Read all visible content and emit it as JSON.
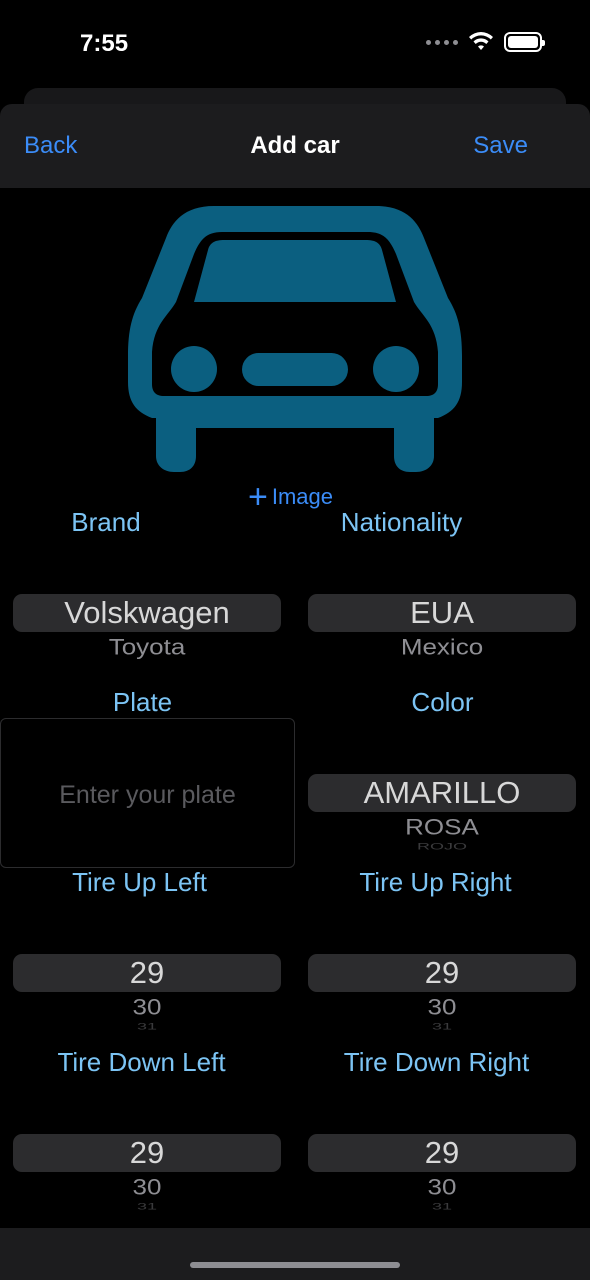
{
  "status": {
    "time": "7:55"
  },
  "nav": {
    "back": "Back",
    "title": "Add car",
    "save": "Save"
  },
  "image": {
    "add_label": "Image"
  },
  "fields": {
    "brand": {
      "label": "Brand",
      "selected": "Volskwagen",
      "next": "Toyota",
      "next2": ""
    },
    "nationality": {
      "label": "Nationality",
      "selected": "EUA",
      "next": "Mexico",
      "next2": ""
    },
    "plate": {
      "label": "Plate",
      "placeholder": "Enter your plate",
      "value": ""
    },
    "color": {
      "label": "Color",
      "selected": "AMARILLO",
      "next": "ROSA",
      "next2": "ROJO"
    },
    "tire_up_left": {
      "label": "Tire Up Left",
      "selected": "29",
      "next": "30",
      "next2": "31"
    },
    "tire_up_right": {
      "label": "Tire Up Right",
      "selected": "29",
      "next": "30",
      "next2": "31"
    },
    "tire_down_left": {
      "label": "Tire Down Left",
      "selected": "29",
      "next": "30",
      "next2": "31"
    },
    "tire_down_right": {
      "label": "Tire Down Right",
      "selected": "29",
      "next": "30",
      "next2": "31"
    }
  },
  "colors": {
    "accent": "#3b8cf7",
    "label": "#7cc4f4",
    "car_icon": "#0b5f80",
    "background": "#000000",
    "bar": "#1c1c1e"
  },
  "icons": {
    "car": "car-icon",
    "plus": "plus-icon",
    "wifi": "wifi-icon",
    "battery": "battery-icon"
  }
}
